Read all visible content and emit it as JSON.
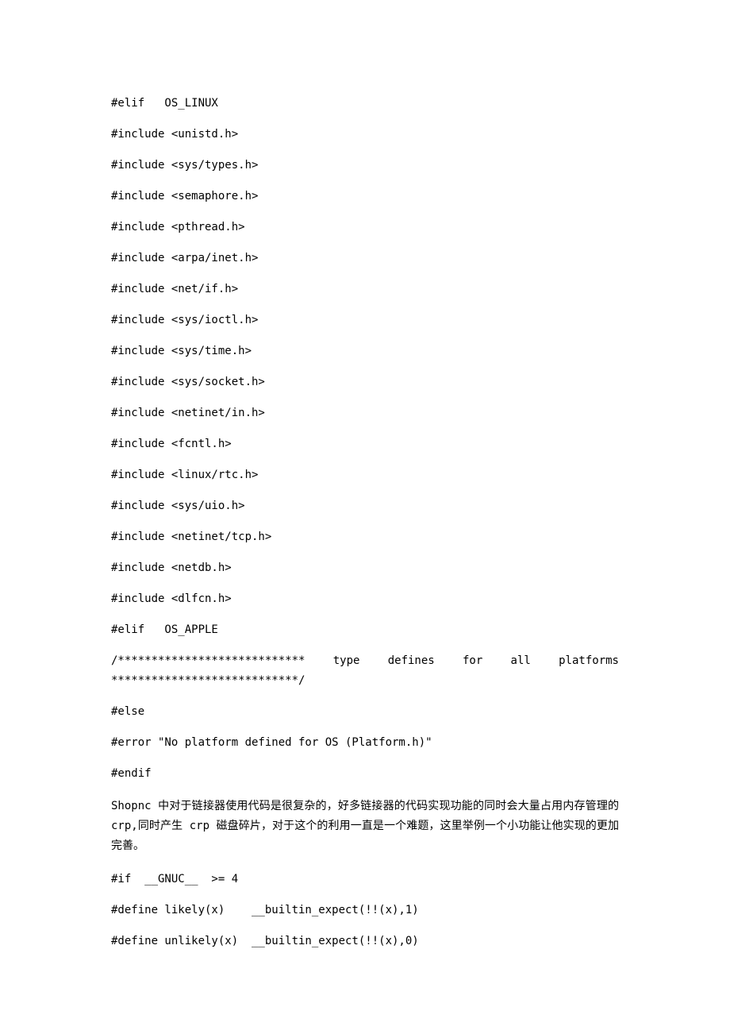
{
  "lines": {
    "l0": "#elif   OS_LINUX",
    "l1": "#include <unistd.h>",
    "l2": "#include <sys/types.h>",
    "l3": "#include <semaphore.h>",
    "l4": "#include <pthread.h>",
    "l5": "#include <arpa/inet.h>",
    "l6": "#include <net/if.h>",
    "l7": "#include <sys/ioctl.h>",
    "l8": "#include <sys/time.h>",
    "l9": "#include <sys/socket.h>",
    "l10": "#include <netinet/in.h>",
    "l11": "#include <fcntl.h>",
    "l12": "#include <linux/rtc.h>",
    "l13": "#include <sys/uio.h>",
    "l14": "#include <netinet/tcp.h>",
    "l15": "#include <netdb.h>",
    "l16": "#include <dlfcn.h>",
    "l17": "#elif   OS_APPLE",
    "l18a": "/**************************** type defines for all platforms",
    "l18b": "****************************/",
    "l19": "#else",
    "l20": "#error \"No platform defined for OS (Platform.h)\"",
    "l21": "#endif",
    "prose": " Shopnc 中对于链接器使用代码是很复杂的，好多链接器的代码实现功能的同时会大量占用内存管理的 crp,同时产生 crp 磁盘碎片，对于这个的利用一直是一个难题，这里举例一个小功能让他实现的更加完善。",
    "l22": "#if  __GNUC__  >= 4",
    "l23": "#define likely(x)    __builtin_expect(!!(x),1)",
    "l24": "#define unlikely(x)  __builtin_expect(!!(x),0)"
  }
}
